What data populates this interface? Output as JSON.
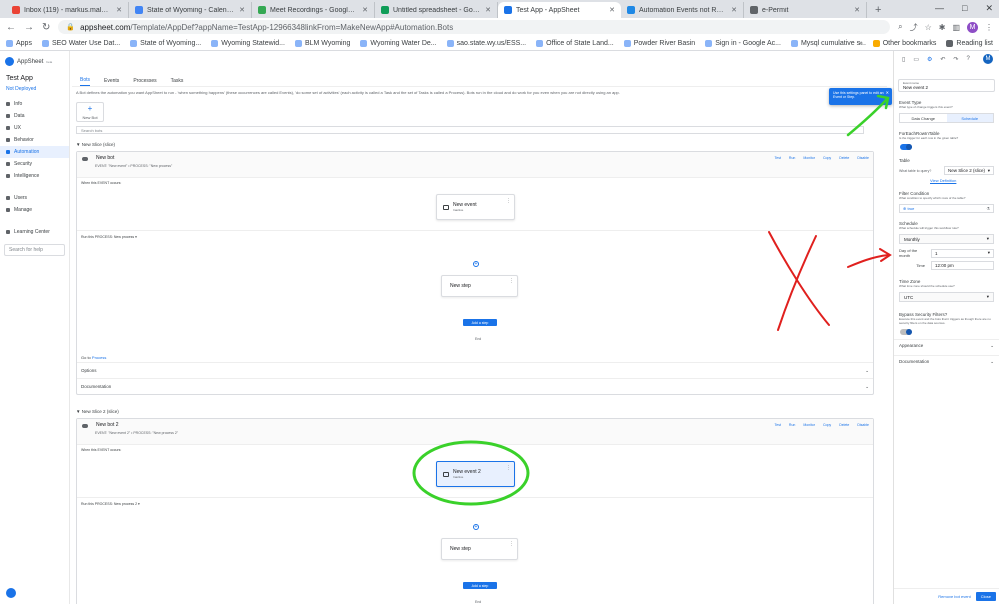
{
  "browser": {
    "tabs": [
      {
        "label": "Inbox (119) - markus.malessa@",
        "color": "#ea4335",
        "active": false
      },
      {
        "label": "State of Wyoming - Calendar - •",
        "color": "#4285f4",
        "active": false
      },
      {
        "label": "Meet Recordings - Google Drive",
        "color": "#34a853",
        "active": false
      },
      {
        "label": "Untitled spreadsheet - Google S",
        "color": "#0f9d58",
        "active": false
      },
      {
        "label": "Test App - AppSheet",
        "color": "#1a73e8",
        "active": true
      },
      {
        "label": "Automation Events not Reflecte",
        "color": "#1e88e5",
        "active": false
      },
      {
        "label": "e-Permit",
        "color": "#5f6368",
        "active": false
      }
    ],
    "new_tab": "+",
    "window_controls": [
      "—",
      "□",
      "✕"
    ],
    "url_domain": "appsheet.com",
    "url_path": "/Template/AppDef?appName=TestApp-12966348linkFrom=MakeNewApp#Automation.Bots",
    "profile_initial": "M",
    "bookmarks": [
      "Apps",
      "SEO Water Use Dat...",
      "State of Wyoming...",
      "Wyoming Statewid...",
      "BLM Wyoming",
      "Wyoming Water De...",
      "sao.state.wy.us/ESS...",
      "Office of State Land...",
      "Powder River Basin",
      "Sign in - Google Ac...",
      "Mysql cumulative s..."
    ],
    "bookmarks_right": [
      "Other bookmarks",
      "Reading list"
    ],
    "more_bookmarks": "»"
  },
  "nav": {
    "brand": "AppSheet",
    "brand_sub": "beta",
    "app_title": "Test App",
    "status": "Not Deployed",
    "items": [
      {
        "label": "Info",
        "active": false
      },
      {
        "label": "Data",
        "active": false
      },
      {
        "label": "UX",
        "active": false
      },
      {
        "label": "Behavior",
        "active": false
      },
      {
        "label": "Automation",
        "active": true
      },
      {
        "label": "Security",
        "active": false
      },
      {
        "label": "Intelligence",
        "active": false
      }
    ],
    "items2": [
      {
        "label": "Users"
      },
      {
        "label": "Manage"
      }
    ],
    "learning": "Learning Center",
    "search_help": "Search for help"
  },
  "main": {
    "tabs": [
      "Bots",
      "Events",
      "Processes",
      "Tasks"
    ],
    "intro": "A Bot defines the automation you want AppSheet to run - 'when something happens' (these occurrences are called Events), 'do some set of activities' (each activity is called a Task and the set of Tasks is called a Process). Bots run in the cloud and do work for you even when you are not directly using an app.",
    "new_bot": "New Bot",
    "search_placeholder": "Search bots",
    "bots": [
      {
        "section": "New Slice (slice)",
        "name": "New bot",
        "desc": "EVENT: \"New event\" • PROCESS: \"New process\"",
        "actions": [
          "Test",
          "Run",
          "Monitor",
          "Copy",
          "Delete",
          "Disable"
        ],
        "when": "When this EVENT occurs:",
        "event": "New event",
        "event_sub": "Inactive",
        "run": "Run this PROCESS:",
        "process": "New process",
        "step": "New step",
        "add_step": "Add a step",
        "end": "End",
        "goto": "Go to",
        "goto_link": "Process",
        "options": "Options",
        "documentation": "Documentation"
      },
      {
        "section": "New Slice 2 (slice)",
        "name": "New bot 2",
        "desc": "EVENT: \"New event 2\" • PROCESS: \"New process 2\"",
        "actions": [
          "Test",
          "Run",
          "Monitor",
          "Copy",
          "Delete",
          "Disable"
        ],
        "when": "When this EVENT occurs:",
        "event": "New event 2",
        "event_sub": "Inactive",
        "run": "Run this PROCESS:",
        "process": "New process 2",
        "step": "New step",
        "add_step": "Add a step",
        "end": "End"
      }
    ]
  },
  "panel": {
    "tooltip": "Use this settings panel to edit an Event or Step.",
    "tooltip_close": "✕",
    "event_name_label": "Event name",
    "event_name": "New event 2",
    "event_type": "Event Type",
    "event_type_hint": "What type of change triggers this event?",
    "seg_options": [
      "Data Change",
      "Schedule"
    ],
    "seg_active": "Schedule",
    "for_each": "ForEachRowInTable",
    "for_each_hint": "Is the trigger for each row in the given table?",
    "table": "Table",
    "table_hint": "What table to query?",
    "table_value": "New Slice 2 (slice)",
    "view_def": "View Definition",
    "filter": "Filter Condition",
    "filter_hint": "What condition to specify which rows of the table?",
    "filter_value": "⊕ true",
    "schedule": "Schedule",
    "schedule_hint": "What schedule will trigger this workflow rule?",
    "schedule_value": "Monthly",
    "day_label": "Day of the month",
    "day_value": "1",
    "time_label": "Time",
    "time_value": "12:00 pm",
    "tz": "Time Zone",
    "tz_hint": "What time zone should the schedule use?",
    "tz_value": "UTC",
    "bypass": "Bypass Security Filters?",
    "bypass_hint": "Execute this event and the bots that it triggers as though there are no security filters on the data sources.",
    "appearance": "Appearance",
    "documentation": "Documentation",
    "remove": "Remove bot event",
    "close": "Close",
    "me": "M"
  },
  "colors": {
    "accent": "#1a73e8",
    "annotation_red": "#e0201e",
    "annotation_green": "#3ad12a"
  }
}
